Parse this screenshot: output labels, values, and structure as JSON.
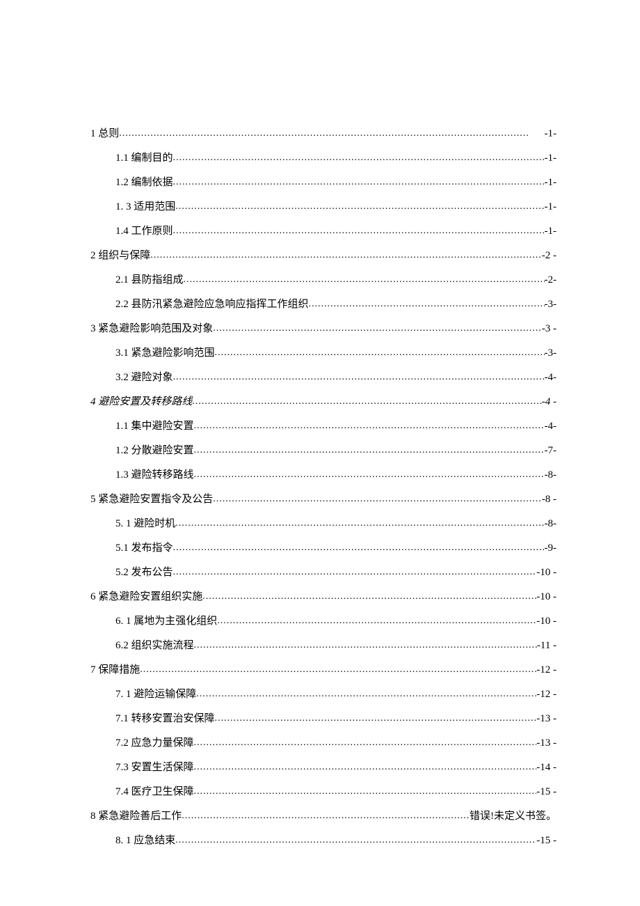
{
  "toc": [
    {
      "level": 1,
      "label": "1 总则",
      "page": "-1-",
      "italic": false
    },
    {
      "level": 2,
      "label": "1.1 编制目的",
      "page": "-1-",
      "italic": false
    },
    {
      "level": 2,
      "label": "1.2 编制依据",
      "page": "-1-",
      "italic": false
    },
    {
      "level": 2,
      "label": "1.  3 适用范围",
      "page": "-1-",
      "italic": false
    },
    {
      "level": 2,
      "label": "1.4 工作原则",
      "page": "-1-",
      "italic": false
    },
    {
      "level": 1,
      "label": "2 组织与保障",
      "page": "-2 -",
      "italic": false
    },
    {
      "level": 2,
      "label": "2.1    县防指组成",
      "page": "-2-",
      "italic": false
    },
    {
      "level": 2,
      "label": "2.2    县防汛紧急避险应急响应指挥工作组织",
      "page": "-3-",
      "italic": false
    },
    {
      "level": 1,
      "label": "3 紧急避险影响范围及对象",
      "page": "-3 -",
      "italic": false
    },
    {
      "level": 2,
      "label": "3.1    紧急避险影响范围",
      "page": "-3-",
      "italic": false
    },
    {
      "level": 2,
      "label": "3.2    避险对象",
      "page": "-4-",
      "italic": false
    },
    {
      "level": 1,
      "label": "4 避险安置及转移路线",
      "page": "-4 -",
      "italic": true
    },
    {
      "level": 2,
      "label": "1.1    集中避险安置",
      "page": "-4-",
      "italic": false
    },
    {
      "level": 2,
      "label": "1.2    分散避险安置",
      "page": "-7-",
      "italic": false
    },
    {
      "level": 2,
      "label": "1.3    避险转移路线",
      "page": "-8-",
      "italic": false
    },
    {
      "level": 1,
      "label": "5 紧急避险安置指令及公告",
      "page": "-8 -",
      "italic": false
    },
    {
      "level": 2,
      "label": "5.  1 避险时机",
      "page": "-8-",
      "italic": false
    },
    {
      "level": 2,
      "label": "5.1    发布指令",
      "page": "-9-",
      "italic": false
    },
    {
      "level": 2,
      "label": "5.2    发布公告",
      "page": "-10      -",
      "italic": false
    },
    {
      "level": 1,
      "label": "6 紧急避险安置组织实施",
      "page": "-10      -",
      "italic": false
    },
    {
      "level": 2,
      "label": "6.  1 属地为主强化组织",
      "page": "-10      -",
      "italic": false
    },
    {
      "level": 2,
      "label": "6.2 组织实施流程",
      "page": "-11      -",
      "italic": false
    },
    {
      "level": 1,
      "label": "7 保障措施",
      "page": "-12      -",
      "italic": false
    },
    {
      "level": 2,
      "label": "7.  1 避险运输保障",
      "page": "-12      -",
      "italic": false
    },
    {
      "level": 2,
      "label": "7.1    转移安置治安保障",
      "page": "-13      -",
      "italic": false
    },
    {
      "level": 2,
      "label": "7.2    应急力量保障",
      "page": "-13      -",
      "italic": false
    },
    {
      "level": 2,
      "label": "7.3    安置生活保障",
      "page": "-14      -",
      "italic": false
    },
    {
      "level": 2,
      "label": "7.4    医疗卫生保障",
      "page": "-15      -",
      "italic": false
    },
    {
      "level": 1,
      "label": "8 紧急避险善后工作",
      "page": "错误!未定义书签。",
      "italic": false
    },
    {
      "level": 2,
      "label": "8.  1 应急结束",
      "page": "-15      -",
      "italic": false
    }
  ]
}
